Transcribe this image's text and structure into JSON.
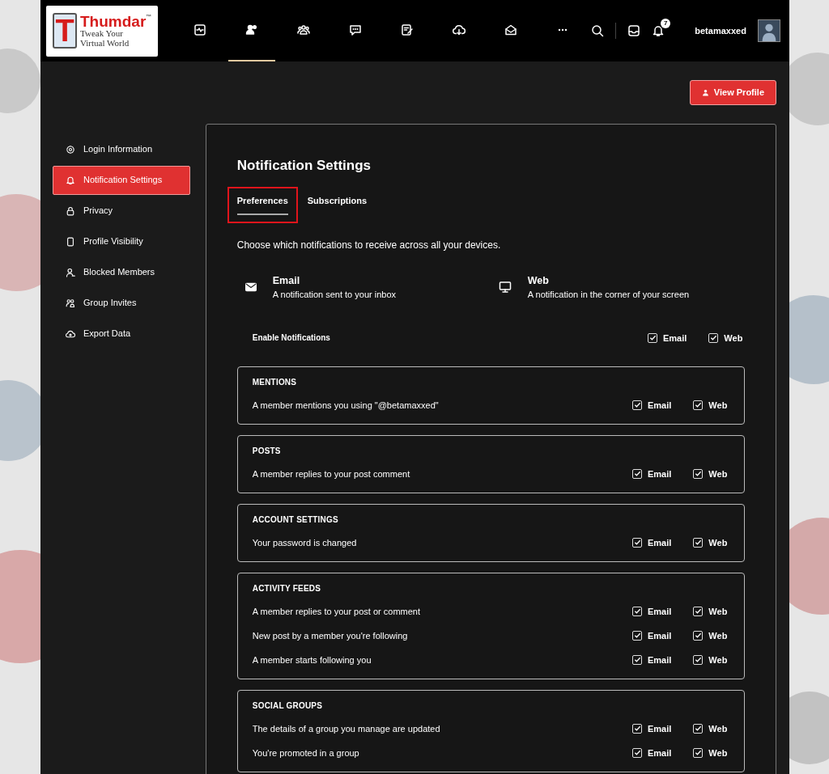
{
  "header": {
    "logo": {
      "mark": "T",
      "name": "Thumdar",
      "tm": "™",
      "tagline": [
        "Tweak Your",
        "Virtual World"
      ]
    },
    "nav_items": [
      {
        "kind": "activity",
        "selected": false
      },
      {
        "kind": "members",
        "selected": true
      },
      {
        "kind": "groups",
        "selected": false
      },
      {
        "kind": "messages",
        "selected": false
      },
      {
        "kind": "notes",
        "selected": false
      },
      {
        "kind": "download",
        "selected": false
      },
      {
        "kind": "mail",
        "selected": false
      },
      {
        "kind": "more",
        "selected": false
      }
    ],
    "notification_count": "7",
    "username": "betamaxxed"
  },
  "view_profile_button": "View Profile",
  "sidebar": {
    "items": [
      {
        "kind": "gear",
        "label": "Login Information",
        "selected": false
      },
      {
        "kind": "bell",
        "label": "Notification Settings",
        "selected": true
      },
      {
        "kind": "lock",
        "label": "Privacy",
        "selected": false
      },
      {
        "kind": "phone",
        "label": "Profile Visibility",
        "selected": false
      },
      {
        "kind": "person",
        "label": "Blocked Members",
        "selected": false
      },
      {
        "kind": "people",
        "label": "Group Invites",
        "selected": false
      },
      {
        "kind": "cloud",
        "label": "Export Data",
        "selected": false
      }
    ]
  },
  "content": {
    "title": "Notification Settings",
    "tabs": [
      {
        "label": "Preferences",
        "selected": true,
        "highlighted": true
      },
      {
        "label": "Subscriptions",
        "selected": false,
        "highlighted": false
      }
    ],
    "intro": "Choose which notifications to receive across all your devices.",
    "channels": [
      {
        "kind": "email",
        "title": "Email",
        "description": "A notification sent to your inbox"
      },
      {
        "kind": "web",
        "title": "Web",
        "description": "A notification in the corner of your screen"
      }
    ],
    "enable": {
      "label": "Enable Notifications",
      "options": [
        {
          "label": "Email",
          "checked": true
        },
        {
          "label": "Web",
          "checked": true
        }
      ]
    },
    "sections": [
      {
        "title": "MENTIONS",
        "rows": [
          {
            "label": "A member mentions you using \"@betamaxxed\"",
            "options": [
              {
                "label": "Email",
                "checked": true
              },
              {
                "label": "Web",
                "checked": true
              }
            ]
          }
        ]
      },
      {
        "title": "POSTS",
        "rows": [
          {
            "label": "A member replies to your post comment",
            "options": [
              {
                "label": "Email",
                "checked": true
              },
              {
                "label": "Web",
                "checked": true
              }
            ]
          }
        ]
      },
      {
        "title": "ACCOUNT SETTINGS",
        "rows": [
          {
            "label": "Your password is changed",
            "options": [
              {
                "label": "Email",
                "checked": true
              },
              {
                "label": "Web",
                "checked": true
              }
            ]
          }
        ]
      },
      {
        "title": "ACTIVITY FEEDS",
        "rows": [
          {
            "label": "A member replies to your post or comment",
            "options": [
              {
                "label": "Email",
                "checked": true
              },
              {
                "label": "Web",
                "checked": true
              }
            ]
          },
          {
            "label": "New post by a member you're following",
            "options": [
              {
                "label": "Email",
                "checked": true
              },
              {
                "label": "Web",
                "checked": true
              }
            ]
          },
          {
            "label": "A member starts following you",
            "options": [
              {
                "label": "Email",
                "checked": true
              },
              {
                "label": "Web",
                "checked": true
              }
            ]
          }
        ]
      },
      {
        "title": "SOCIAL GROUPS",
        "rows": [
          {
            "label": "The details of a group you manage are updated",
            "options": [
              {
                "label": "Email",
                "checked": true
              },
              {
                "label": "Web",
                "checked": true
              }
            ]
          },
          {
            "label": "You're promoted in a group",
            "options": [
              {
                "label": "Email",
                "checked": true
              },
              {
                "label": "Web",
                "checked": true
              }
            ]
          }
        ]
      }
    ]
  }
}
